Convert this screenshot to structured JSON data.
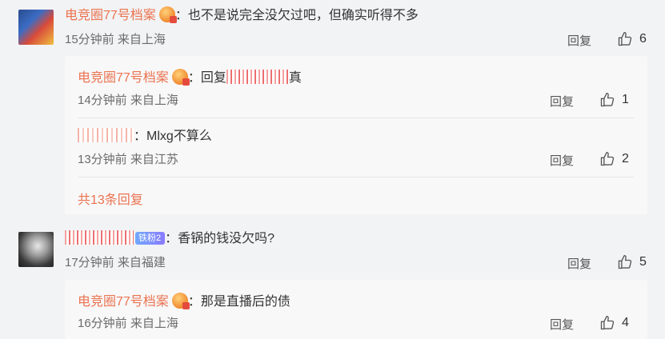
{
  "comments": [
    {
      "author": "电竞圈77号档案",
      "text": "：也不是说完全没欠过吧，但确实听得不多",
      "time": "15分钟前 来自上海",
      "reply_label": "回复",
      "likes": "6",
      "replies": [
        {
          "author": "电竞圈77号档案",
          "prefix": "：回复",
          "text": "真",
          "time": "14分钟前 来自上海",
          "reply_label": "回复",
          "likes": "1"
        },
        {
          "author": "",
          "text": "：Mlxg不算么",
          "time": "13分钟前 来自江苏",
          "reply_label": "回复",
          "likes": "2"
        }
      ],
      "total_replies": "共13条回复"
    },
    {
      "author": "",
      "fan_badge": "铁粉2",
      "text": "：香锅的钱没欠吗?",
      "time": "17分钟前 来自福建",
      "reply_label": "回复",
      "likes": "5",
      "replies": [
        {
          "author": "电竞圈77号档案",
          "text": "：那是直播后的债",
          "time": "16分钟前 来自上海",
          "reply_label": "回复",
          "likes": "4"
        }
      ]
    }
  ],
  "icons": {
    "like": "thumbs-up-icon",
    "badge": "verified-badge-icon"
  },
  "colors": {
    "username": "#eb7350",
    "background": "#f2f3f5",
    "subpanel": "#f8f8f9"
  }
}
